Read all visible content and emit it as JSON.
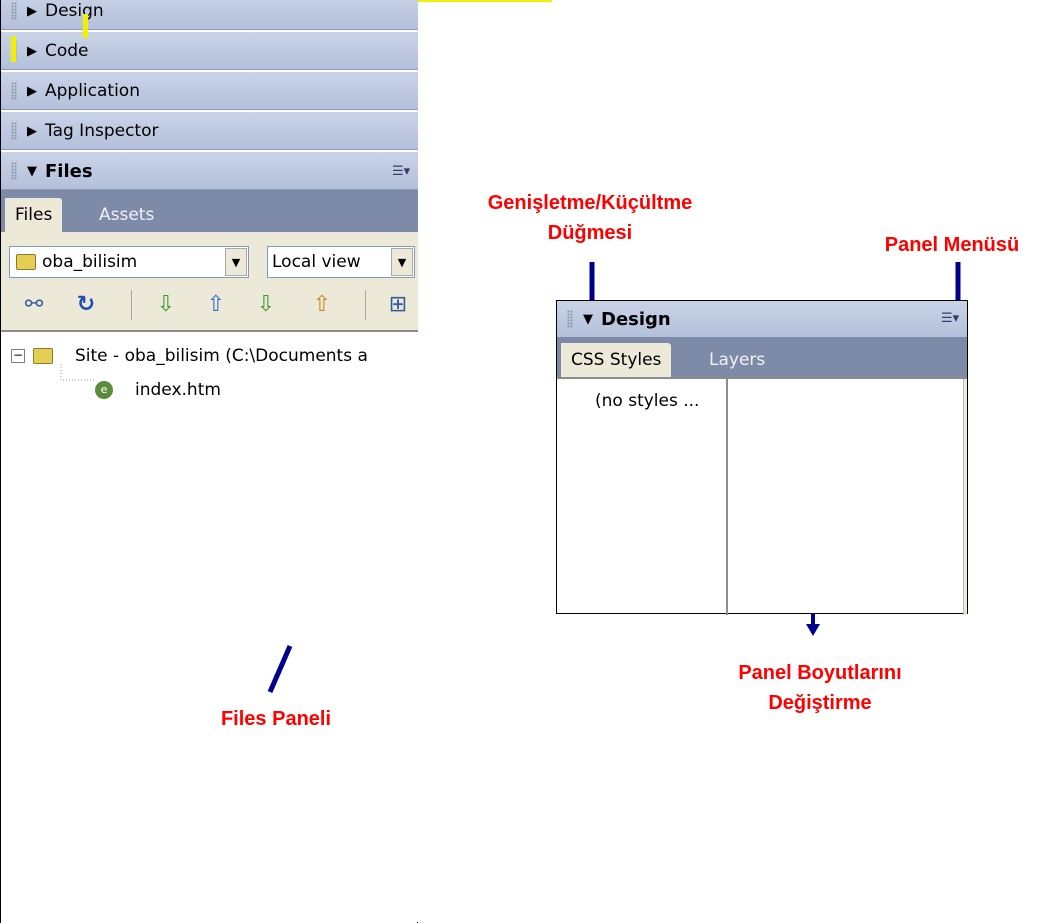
{
  "left_panel": {
    "groups": [
      {
        "label": "Design",
        "arrow": "▶"
      },
      {
        "label": "Code",
        "arrow": "▶"
      },
      {
        "label": "Application",
        "arrow": "▶"
      },
      {
        "label": "Tag Inspector",
        "arrow": "▶"
      }
    ],
    "files_header": {
      "label": "Files",
      "arrow": "▼",
      "menu_icon": "panel-menu-icon"
    },
    "tabs": {
      "active": "Files",
      "inactive": "Assets"
    },
    "site_select": {
      "value": "oba_bilisim"
    },
    "view_select": {
      "value": "Local view"
    },
    "toolbar_icons": [
      "connect-icon",
      "refresh-icon",
      "get-icon",
      "put-icon",
      "check-out-icon",
      "check-in-icon",
      "expand-icon"
    ],
    "tree": {
      "root": "Site - oba_bilisim (C:\\Documents a",
      "child": "index.htm"
    }
  },
  "design_panel": {
    "header": {
      "label": "Design",
      "arrow": "▼"
    },
    "tabs": {
      "active": "CSS Styles",
      "inactive": "Layers"
    },
    "content": "(no styles ..."
  },
  "callouts": {
    "expand_collapse_line1": "Genişletme/Küçültme",
    "expand_collapse_line2": "Düğmesi",
    "panel_menu": "Panel Menüsü",
    "resize_line1": "Panel Boyutlarını",
    "resize_line2": "Değiştirme",
    "files_panel": "Files Paneli"
  },
  "colors": {
    "callout_text": "#ff0000",
    "pointer": "#00008b",
    "header_bar": "#c0cbe2",
    "tab_strip": "#7d8aa8",
    "highlight": "#f0f000"
  }
}
